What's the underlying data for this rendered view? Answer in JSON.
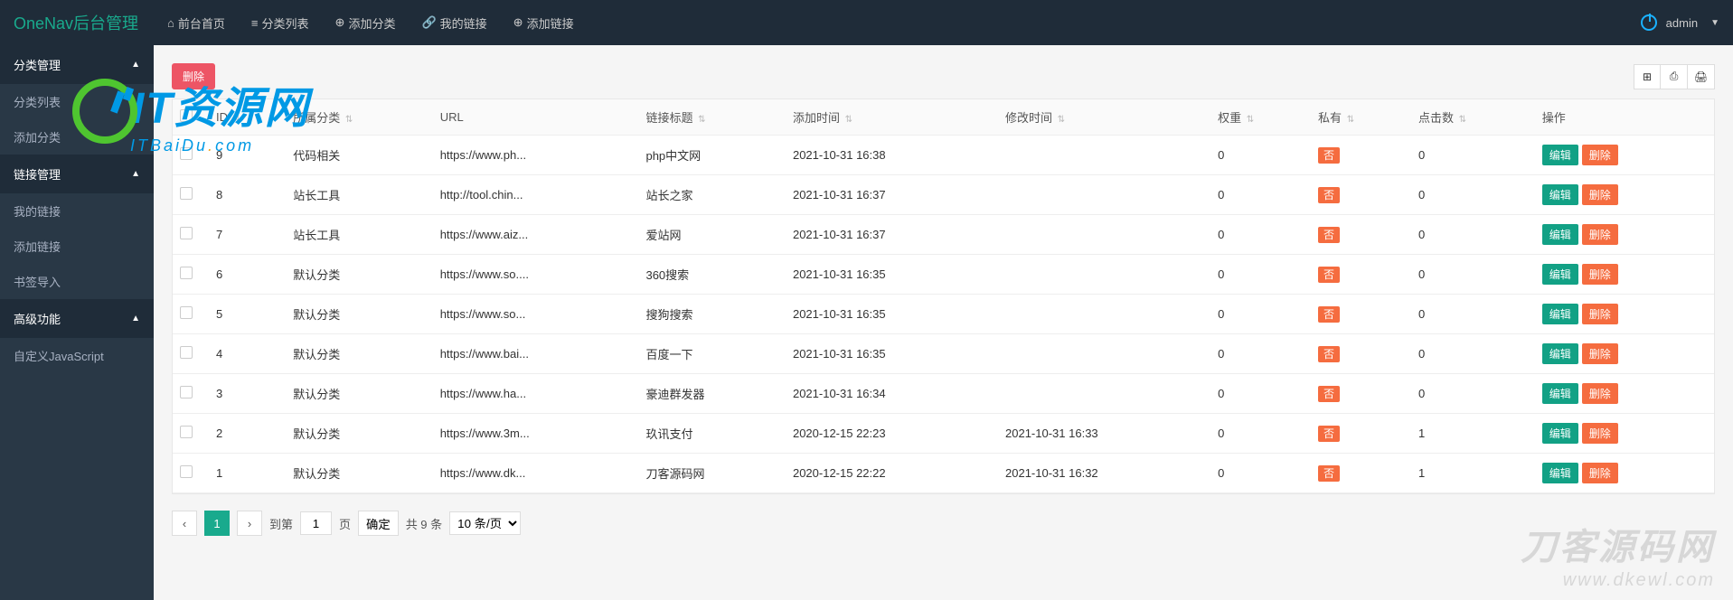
{
  "brand": "OneNav后台管理",
  "topnav": [
    {
      "icon": "⌂",
      "label": "前台首页"
    },
    {
      "icon": "≡",
      "label": "分类列表"
    },
    {
      "icon": "⊕",
      "label": "添加分类"
    },
    {
      "icon": "🔗",
      "label": "我的链接"
    },
    {
      "icon": "⊕",
      "label": "添加链接"
    }
  ],
  "user": {
    "name": "admin"
  },
  "sidebar": [
    {
      "type": "group",
      "label": "分类管理"
    },
    {
      "type": "item",
      "label": "分类列表"
    },
    {
      "type": "item",
      "label": "添加分类"
    },
    {
      "type": "group",
      "label": "链接管理"
    },
    {
      "type": "item",
      "label": "我的链接"
    },
    {
      "type": "item",
      "label": "添加链接"
    },
    {
      "type": "item",
      "label": "书签导入"
    },
    {
      "type": "group",
      "label": "高级功能"
    },
    {
      "type": "item",
      "label": "自定义JavaScript"
    }
  ],
  "toolbar": {
    "delete_label": "删除"
  },
  "columns": [
    "",
    "ID",
    "所属分类",
    "URL",
    "链接标题",
    "添加时间",
    "修改时间",
    "权重",
    "私有",
    "点击数",
    "操作"
  ],
  "sortable_cols": [
    1,
    2,
    4,
    5,
    6,
    7,
    8,
    9
  ],
  "rows": [
    {
      "id": "9",
      "cat": "代码相关",
      "url": "https://www.ph...",
      "title": "php中文网",
      "add": "2021-10-31 16:38",
      "mod": "",
      "weight": "0",
      "priv": "否",
      "clicks": "0"
    },
    {
      "id": "8",
      "cat": "站长工具",
      "url": "http://tool.chin...",
      "title": "站长之家",
      "add": "2021-10-31 16:37",
      "mod": "",
      "weight": "0",
      "priv": "否",
      "clicks": "0"
    },
    {
      "id": "7",
      "cat": "站长工具",
      "url": "https://www.aiz...",
      "title": "爱站网",
      "add": "2021-10-31 16:37",
      "mod": "",
      "weight": "0",
      "priv": "否",
      "clicks": "0"
    },
    {
      "id": "6",
      "cat": "默认分类",
      "url": "https://www.so....",
      "title": "360搜索",
      "add": "2021-10-31 16:35",
      "mod": "",
      "weight": "0",
      "priv": "否",
      "clicks": "0"
    },
    {
      "id": "5",
      "cat": "默认分类",
      "url": "https://www.so...",
      "title": "搜狗搜索",
      "add": "2021-10-31 16:35",
      "mod": "",
      "weight": "0",
      "priv": "否",
      "clicks": "0"
    },
    {
      "id": "4",
      "cat": "默认分类",
      "url": "https://www.bai...",
      "title": "百度一下",
      "add": "2021-10-31 16:35",
      "mod": "",
      "weight": "0",
      "priv": "否",
      "clicks": "0"
    },
    {
      "id": "3",
      "cat": "默认分类",
      "url": "https://www.ha...",
      "title": "豪迪群发器",
      "add": "2021-10-31 16:34",
      "mod": "",
      "weight": "0",
      "priv": "否",
      "clicks": "0"
    },
    {
      "id": "2",
      "cat": "默认分类",
      "url": "https://www.3m...",
      "title": "玖讯支付",
      "add": "2020-12-15 22:23",
      "mod": "2021-10-31 16:33",
      "weight": "0",
      "priv": "否",
      "clicks": "1"
    },
    {
      "id": "1",
      "cat": "默认分类",
      "url": "https://www.dk...",
      "title": "刀客源码网",
      "add": "2020-12-15 22:22",
      "mod": "2021-10-31 16:32",
      "weight": "0",
      "priv": "否",
      "clicks": "1"
    }
  ],
  "actions": {
    "edit": "编辑",
    "delete": "删除"
  },
  "pagination": {
    "prev": "‹",
    "current": "1",
    "next": "›",
    "goto_label": "到第",
    "goto_value": "1",
    "page_label": "页",
    "confirm": "确定",
    "total": "共 9 条",
    "per_page": "10 条/页"
  },
  "watermark1": {
    "big_text": "IT资源网",
    "sub_text": "ITBaiDu",
    "sub_suffix": "com"
  },
  "watermark2": {
    "line1": "刀客源码网",
    "line2": "www.dkewl.com"
  }
}
